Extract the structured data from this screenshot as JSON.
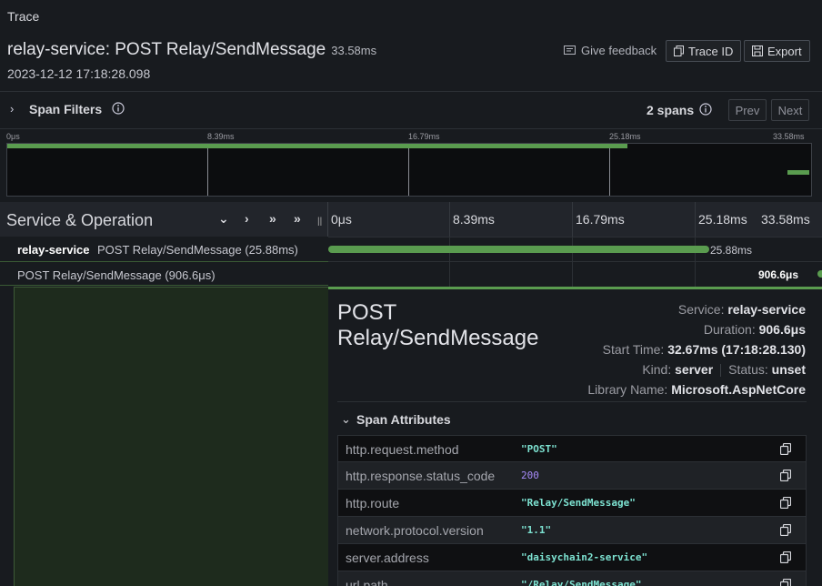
{
  "panel": {
    "title": "Trace"
  },
  "trace": {
    "heading": "relay-service: POST Relay/SendMessage",
    "duration": "33.58ms",
    "start_time": "2023-12-12 17:18:28.098"
  },
  "toolbar": {
    "feedback_label": "Give feedback",
    "trace_id_label": "Trace ID",
    "export_label": "Export"
  },
  "filters": {
    "label": "Span Filters",
    "spans_count": "2 spans",
    "prev_label": "Prev",
    "next_label": "Next"
  },
  "minimap": {
    "ticks": [
      "0μs",
      "8.39ms",
      "16.79ms",
      "25.18ms",
      "33.58ms"
    ]
  },
  "timeline_header": {
    "label": "Service & Operation",
    "ticks": [
      "0μs",
      "8.39ms",
      "16.79ms",
      "25.18ms",
      "33.58ms"
    ]
  },
  "spans": [
    {
      "service": "relay-service",
      "operation": "POST Relay/SendMessage (25.88ms)",
      "bar_label": "25.88ms",
      "start_fraction": 0.0,
      "duration_fraction": 0.771
    },
    {
      "operation": "POST Relay/SendMessage (906.6μs)",
      "bar_label": "906.6μs",
      "start_fraction": 0.973,
      "duration_fraction": 0.027
    }
  ],
  "detail": {
    "title": "POST Relay/SendMessage",
    "service_label": "Service:",
    "service_value": "relay-service",
    "duration_label": "Duration:",
    "duration_value": "906.6μs",
    "start_label": "Start Time:",
    "start_value": "32.67ms (17:18:28.130)",
    "kind_label": "Kind:",
    "kind_value": "server",
    "status_label": "Status:",
    "status_value": "unset",
    "library_label": "Library Name:",
    "library_value": "Microsoft.AspNetCore",
    "attributes_label": "Span Attributes",
    "attributes": [
      {
        "key": "http.request.method",
        "value": "\"POST\""
      },
      {
        "key": "http.response.status_code",
        "value": "200"
      },
      {
        "key": "http.route",
        "value": "\"Relay/SendMessage\""
      },
      {
        "key": "network.protocol.version",
        "value": "\"1.1\""
      },
      {
        "key": "server.address",
        "value": "\"daisychain2-service\""
      },
      {
        "key": "url.path",
        "value": "\"/Relay/SendMessage\""
      }
    ]
  },
  "colors": {
    "span_bar": "#5a9c4f",
    "string_value": "#7de2d1",
    "number_value": "#a78bfa"
  }
}
